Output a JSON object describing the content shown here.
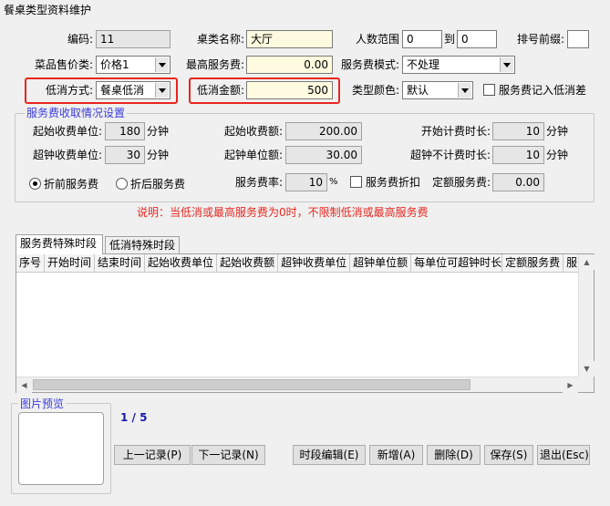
{
  "window": {
    "title": "餐桌类型资料维护"
  },
  "form": {
    "code": {
      "label": "编码:",
      "value": "11"
    },
    "table_name": {
      "label": "桌类名称:",
      "value": "大厅"
    },
    "people_range": {
      "label": "人数范围",
      "from": "0",
      "to_label": "到",
      "to": "0"
    },
    "row_prefix": {
      "label": "排号前缀:",
      "value": ""
    },
    "dish_price": {
      "label": "菜品售价类:",
      "value": "价格1"
    },
    "max_service_fee": {
      "label": "最高服务费:",
      "value": "0.00"
    },
    "service_fee_mode": {
      "label": "服务费模式:",
      "value": "不处理"
    },
    "min_consume_mode": {
      "label": "低消方式:",
      "value": "餐桌低消"
    },
    "min_consume_amount": {
      "label": "低消金额:",
      "value": "500"
    },
    "type_color": {
      "label": "类型颜色:",
      "value": "默认"
    },
    "fee_into_min": {
      "label": "服务费记入低消差",
      "checked": false
    }
  },
  "fee_group": {
    "title": "服务费收取情况设置",
    "start_unit": {
      "label": "起始收费单位:",
      "value": "180",
      "unit": "分钟"
    },
    "start_amount": {
      "label": "起始收费额:",
      "value": "200.00"
    },
    "start_timing": {
      "label": "开始计费时长:",
      "value": "10",
      "unit": "分钟"
    },
    "over_unit": {
      "label": "超钟收费单位:",
      "value": "30",
      "unit": "分钟"
    },
    "over_amount": {
      "label": "起钟单位额:",
      "value": "30.00"
    },
    "over_free": {
      "label": "超钟不计费时长:",
      "value": "10",
      "unit": "分钟"
    },
    "radio_before": {
      "label": "折前服务费",
      "checked": true
    },
    "radio_after": {
      "label": "折后服务费",
      "checked": false
    },
    "fee_rate": {
      "label": "服务费率:",
      "value": "10",
      "unit": "%"
    },
    "fee_discount": {
      "label": "服务费折扣",
      "checked": false
    },
    "fixed_fee": {
      "label": "定额服务费:",
      "value": "0.00"
    }
  },
  "note": "说明：当低消或最高服务费为0时，不限制低消或最高服务费",
  "tabs": [
    {
      "label": "服务费特殊时段",
      "active": true
    },
    {
      "label": "低消特殊时段",
      "active": false
    }
  ],
  "grid": {
    "columns": [
      "序号",
      "开始时间",
      "结束时间",
      "起始收费单位",
      "起始收费额",
      "超钟收费单位",
      "超钟单位额",
      "每单位可超钟时长",
      "定额服务费",
      "服务"
    ],
    "rows": []
  },
  "preview": {
    "title": "图片预览"
  },
  "pager": {
    "text": "1 / 5"
  },
  "buttons": {
    "prev": "上一记录(P)",
    "next": "下一记录(N)",
    "edit_period": "时段编辑(E)",
    "add": "新增(A)",
    "delete": "删除(D)",
    "save": "保存(S)",
    "exit": "退出(Esc)"
  },
  "colors": {
    "highlight": "#e8261f",
    "group_title": "#3a3adf",
    "note": "#e8261f",
    "pager": "#1c1ca8"
  }
}
